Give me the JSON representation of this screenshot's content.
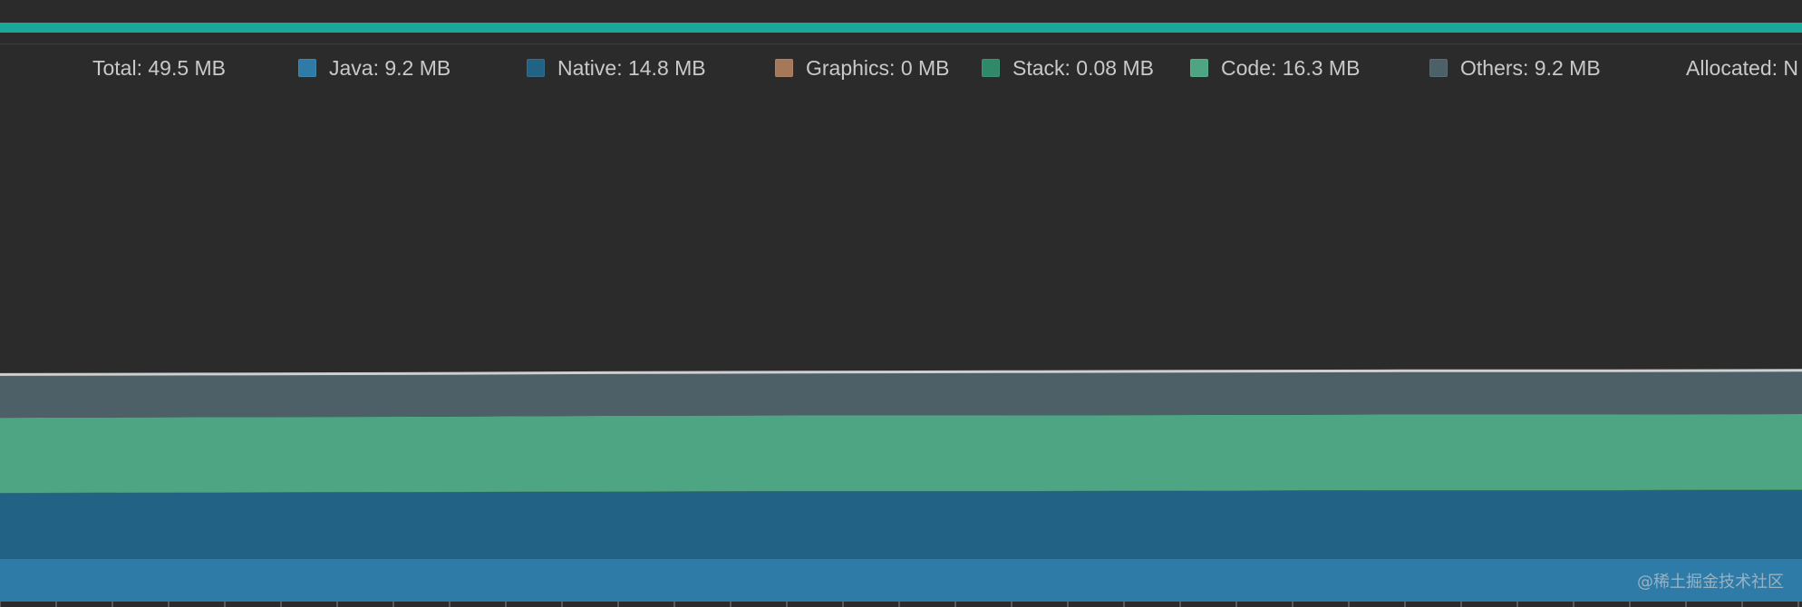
{
  "legend": {
    "total": "Total: 49.5 MB",
    "items": [
      {
        "label": "Java: 9.2 MB",
        "color": "#2f7ba8"
      },
      {
        "label": "Native: 14.8 MB",
        "color": "#216285"
      },
      {
        "label": "Graphics: 0 MB",
        "color": "#a6785a"
      },
      {
        "label": "Stack: 0.08 MB",
        "color": "#2f8a69"
      },
      {
        "label": "Code: 16.3 MB",
        "color": "#4ea584"
      },
      {
        "label": "Others: 9.2 MB",
        "color": "#4d6068"
      }
    ],
    "allocated": "Allocated: N"
  },
  "colors": {
    "background": "#2b2b2b",
    "accent": "#19a99b",
    "total_line": "#cfcfcf"
  },
  "chart_data": {
    "type": "area",
    "stacked": true,
    "x": [
      0,
      1,
      2,
      3,
      4,
      5,
      6,
      7,
      8,
      9
    ],
    "series": [
      {
        "name": "Java",
        "color": "#2f7ba8",
        "values": [
          9.2,
          9.2,
          9.2,
          9.2,
          9.2,
          9.2,
          9.2,
          9.2,
          9.2,
          9.2
        ]
      },
      {
        "name": "Native",
        "color": "#216285",
        "values": [
          14.1,
          14.2,
          14.3,
          14.4,
          14.5,
          14.5,
          14.6,
          14.7,
          14.7,
          14.8
        ]
      },
      {
        "name": "Graphics",
        "color": "#a6785a",
        "values": [
          0,
          0,
          0,
          0,
          0,
          0,
          0,
          0,
          0,
          0
        ]
      },
      {
        "name": "Stack",
        "color": "#2f8a69",
        "values": [
          0.08,
          0.08,
          0.08,
          0.08,
          0.08,
          0.08,
          0.08,
          0.08,
          0.08,
          0.08
        ]
      },
      {
        "name": "Code",
        "color": "#4ea584",
        "values": [
          16.2,
          16.2,
          16.2,
          16.3,
          16.3,
          16.3,
          16.3,
          16.3,
          16.3,
          16.3
        ]
      },
      {
        "name": "Others",
        "color": "#4d6068",
        "values": [
          9.1,
          9.1,
          9.1,
          9.1,
          9.1,
          9.2,
          9.2,
          9.2,
          9.2,
          9.2
        ]
      }
    ],
    "ylim": [
      0,
      110
    ],
    "grid": false
  },
  "watermark": "@稀土掘金技术社区"
}
